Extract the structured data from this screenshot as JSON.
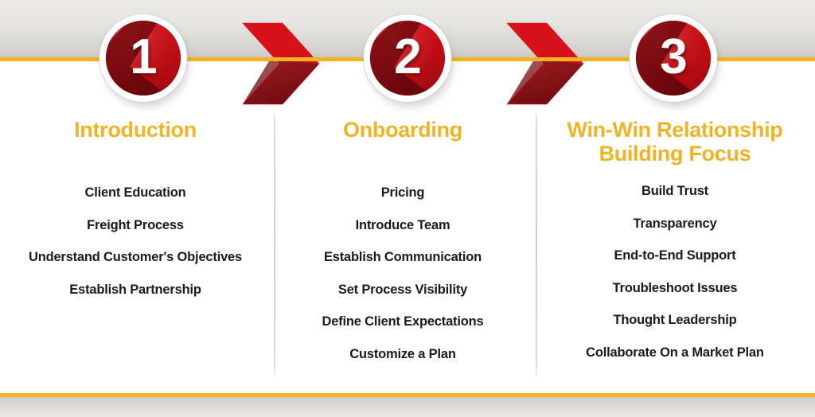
{
  "theme": {
    "accent_gold": "#F0B323",
    "accent_red": "#D50F17",
    "accent_red_dark": "#8E0A10",
    "band_gray": "#E8E7E4",
    "text_dark": "#1A1A1A"
  },
  "decor": {
    "top_rule_color": "#F0B323",
    "bottom_rule_color": "#F0B323",
    "chevron_icon": "double-chevron-right-icon"
  },
  "columns": [
    {
      "number": "1",
      "heading": "Introduction",
      "items": [
        "Client Education",
        "Freight Process",
        "Understand Customer's Objectives",
        "Establish Partnership"
      ]
    },
    {
      "number": "2",
      "heading": "Onboarding",
      "items": [
        "Pricing",
        "Introduce Team",
        "Establish Communication",
        "Set Process Visibility",
        "Define Client Expectations",
        "Customize a Plan"
      ]
    },
    {
      "number": "3",
      "heading": "Win-Win Relationship\nBuilding Focus",
      "items": [
        "Build Trust",
        "Transparency",
        "End-to-End Support",
        "Troubleshoot Issues",
        "Thought Leadership",
        "Collaborate On a Market Plan"
      ]
    }
  ]
}
